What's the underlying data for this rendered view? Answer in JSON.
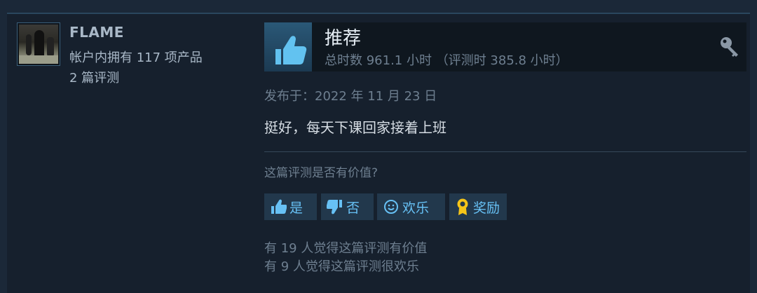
{
  "review": {
    "user": {
      "name": "FLAME",
      "products": "帐户内拥有 117 项产品",
      "reviews": "2 篇评测"
    },
    "verdict": "推荐",
    "hours": "总时数 961.1 小时 （评测时 385.8 小时）",
    "posted": "发布于：2022 年 11 月 23 日",
    "text": "挺好，每天下课回家接着上班",
    "helpful_question": "这篇评测是否有价值?",
    "buttons": {
      "yes": "是",
      "no": "否",
      "funny": "欢乐",
      "award": "奖励"
    },
    "stats": {
      "helpful": "有 19 人觉得这篇评测有价值",
      "funny": "有 9 人觉得这篇评测很欢乐"
    }
  },
  "colors": {
    "background": "#1b2838",
    "card": "#16202d",
    "button_text": "#67c1f5",
    "button_bg": "#22384c",
    "award_gold": "#f5c518"
  },
  "icons": [
    "thumbs-up-icon",
    "thumbs-down-icon",
    "smiley-icon",
    "award-icon",
    "key-icon"
  ]
}
